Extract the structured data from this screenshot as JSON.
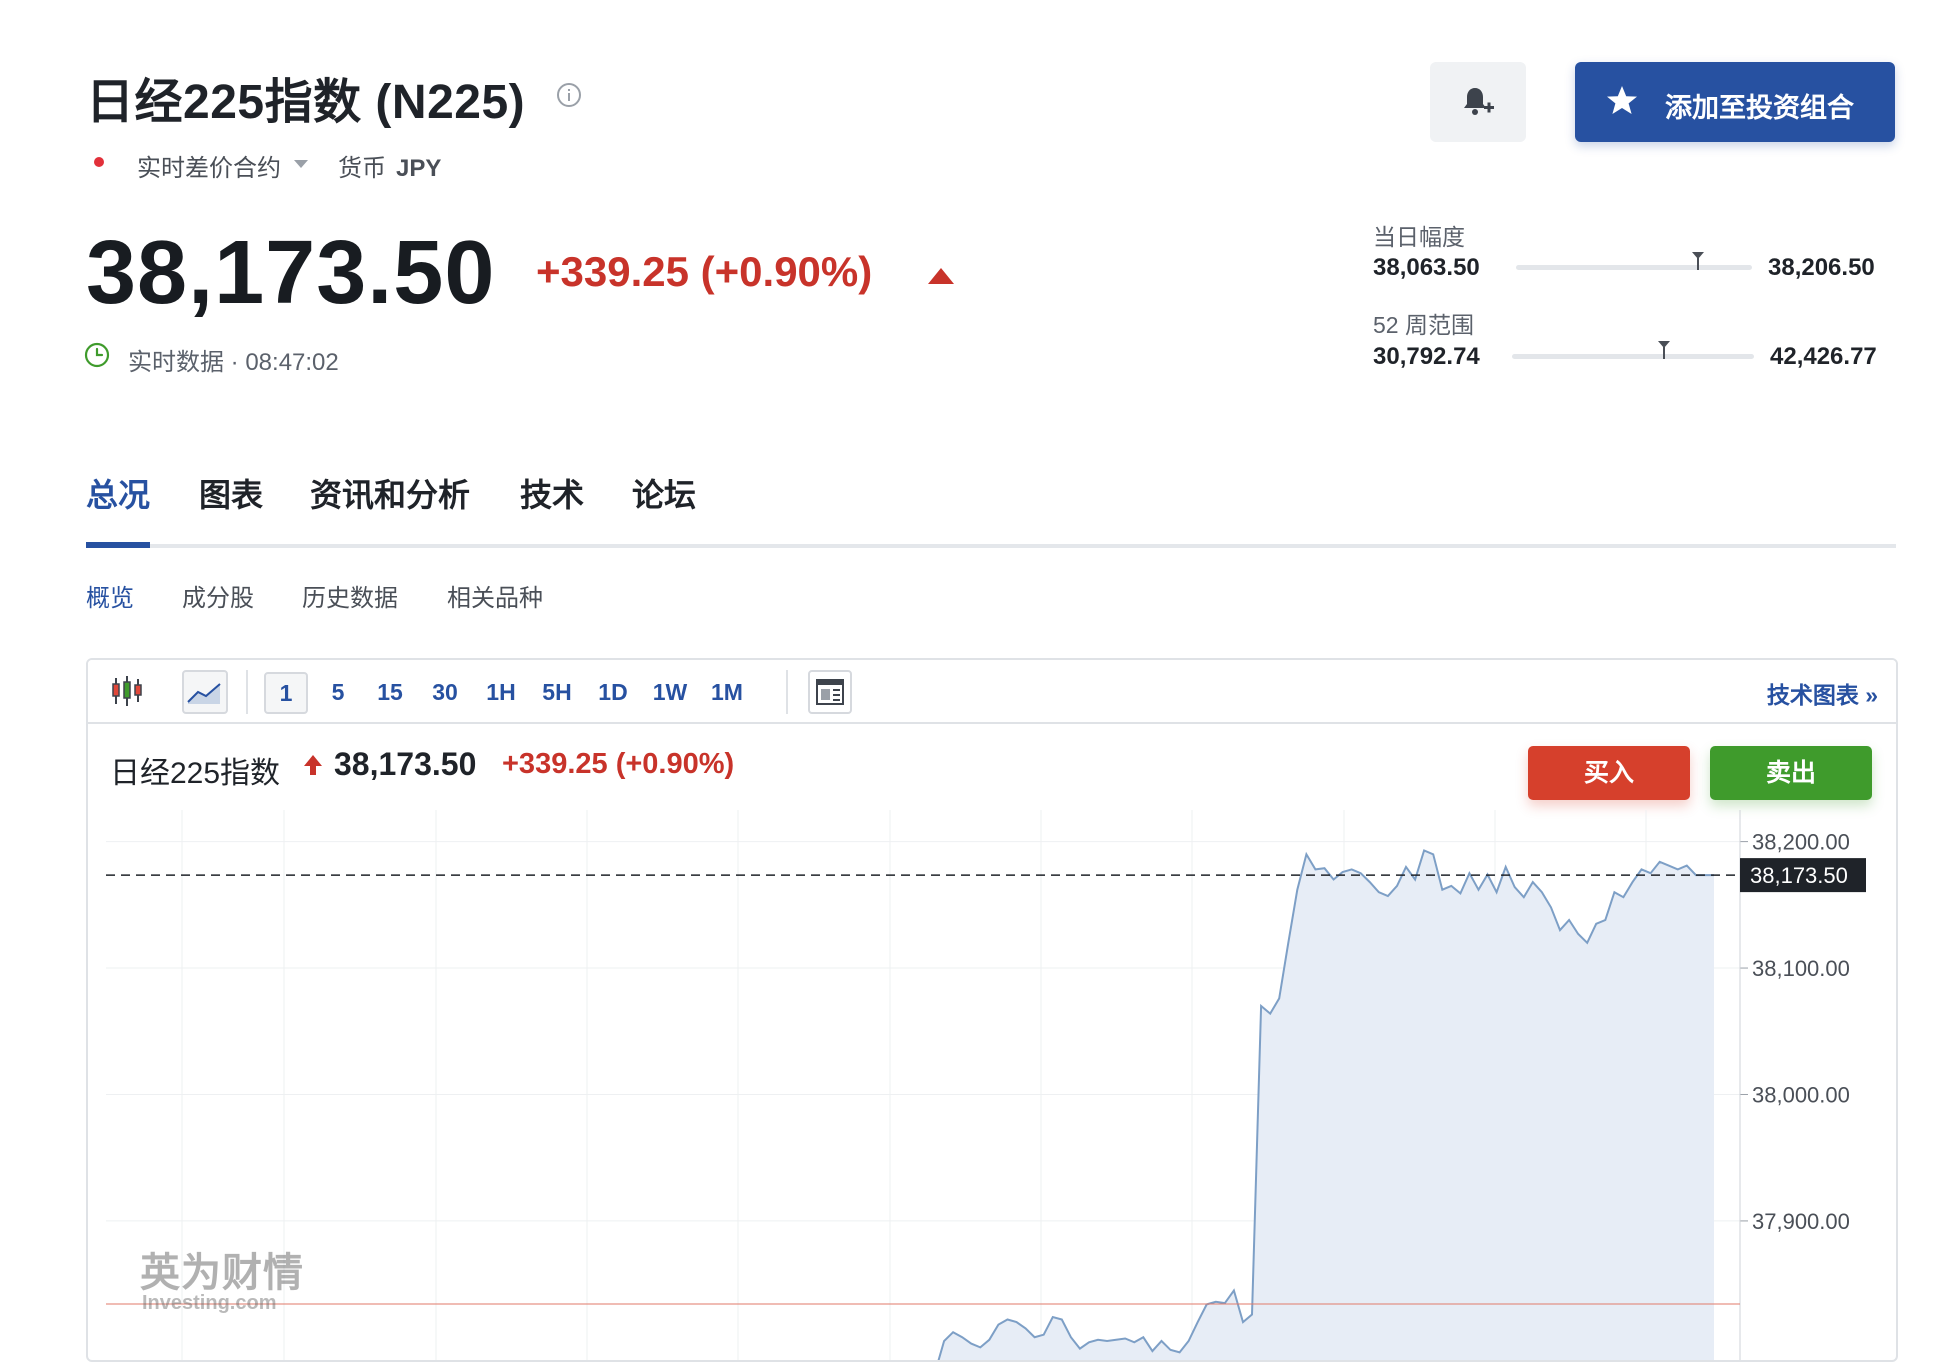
{
  "header": {
    "title": "日经225指数 (N225)",
    "contract_type": "实时差价合约",
    "currency_label": "货币",
    "currency": "JPY",
    "price": "38,173.50",
    "change": "+339.25 (+0.90%)",
    "realtime_label": "实时数据 · 08:47:02",
    "alert_button_icon": "bell-plus-icon",
    "add_portfolio_label": "添加至投资组合"
  },
  "ranges": {
    "day_label": "当日幅度",
    "day_low": "38,063.50",
    "day_high": "38,206.50",
    "day_position": 0.77,
    "week52_label": "52 周范围",
    "week52_low": "30,792.74",
    "week52_high": "42,426.77",
    "week52_position": 0.63
  },
  "tabs": [
    {
      "label": "总况",
      "active": true
    },
    {
      "label": "图表",
      "active": false
    },
    {
      "label": "资讯和分析",
      "active": false
    },
    {
      "label": "技术",
      "active": false
    },
    {
      "label": "论坛",
      "active": false
    }
  ],
  "subtabs": [
    {
      "label": "概览",
      "active": true
    },
    {
      "label": "成分股",
      "active": false
    },
    {
      "label": "历史数据",
      "active": false
    },
    {
      "label": "相关品种",
      "active": false
    }
  ],
  "chart_toolbar": {
    "intervals": [
      "1",
      "5",
      "15",
      "30",
      "1H",
      "5H",
      "1D",
      "1W",
      "1M"
    ],
    "selected_interval": "1",
    "tech_chart_link": "技术图表 »"
  },
  "chart_info": {
    "name": "日经225指数",
    "price": "38,173.50",
    "change": "+339.25 (+0.90%)",
    "buy_label": "买入",
    "sell_label": "卖出"
  },
  "watermark": {
    "cn": "英为财情",
    "en": "Investing.com"
  },
  "chart_data": {
    "type": "area",
    "y_ticks": [
      "38,200.00",
      "38,100.00",
      "38,000.00",
      "37,900.00"
    ],
    "ylim": [
      37790,
      38225
    ],
    "current_value": 38173.5,
    "current_value_label": "38,173.50",
    "previous_close": 37834.25,
    "colors": {
      "line": "#7d9fc6",
      "fill": "#e7edf6",
      "current": "#1f2329",
      "prev_close": "#e07a6a"
    },
    "values": [
      37780,
      37805,
      37812,
      37808,
      37803,
      37800,
      37806,
      37818,
      37822,
      37820,
      37815,
      37808,
      37810,
      37824,
      37822,
      37808,
      37799,
      37804,
      37806,
      37805,
      37806,
      37807,
      37804,
      37808,
      37797,
      37805,
      37798,
      37796,
      37805,
      37820,
      37834,
      37836,
      37835,
      37845,
      37820,
      37826,
      38070,
      38064,
      38076,
      38120,
      38162,
      38190,
      38178,
      38179,
      38170,
      38176,
      38178,
      38175,
      38168,
      38160,
      38157,
      38165,
      38180,
      38170,
      38193,
      38190,
      38162,
      38165,
      38159,
      38175,
      38162,
      38174,
      38160,
      38180,
      38164,
      38156,
      38168,
      38160,
      38148,
      38130,
      38138,
      38127,
      38120,
      38135,
      38138,
      38160,
      38156,
      38168,
      38178,
      38175,
      38184,
      38181,
      38178,
      38181,
      38173.5,
      38173.5,
      38173.5
    ]
  }
}
